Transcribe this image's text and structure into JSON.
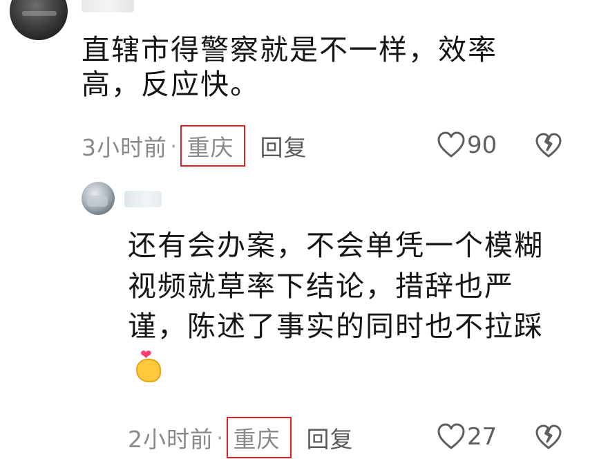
{
  "comments": [
    {
      "text": "直辖市得警察就是不一样，效率高，反应快。",
      "time": "3小时前",
      "separator": "·",
      "location": "重庆",
      "reply_label": "回复",
      "likes": "90",
      "avatar_icon": "user-avatar",
      "dislike_icon": "broken-heart-icon",
      "like_icon": "heart-outline-icon"
    },
    {
      "text": "还有会办案，不会单凭一个模糊视频就草率下结论，措辞也严谨，陈述了事实的同时也不拉踩",
      "emoji": "finger-heart-emoji",
      "time": "2小时前",
      "separator": "·",
      "location": "重庆",
      "reply_label": "回复",
      "likes": "27",
      "avatar_icon": "user-avatar",
      "dislike_icon": "broken-heart-icon",
      "like_icon": "heart-outline-icon"
    }
  ],
  "colors": {
    "location_box_border": "#e0201e",
    "meta_text": "#8a8a8a",
    "body_text": "#161616"
  }
}
